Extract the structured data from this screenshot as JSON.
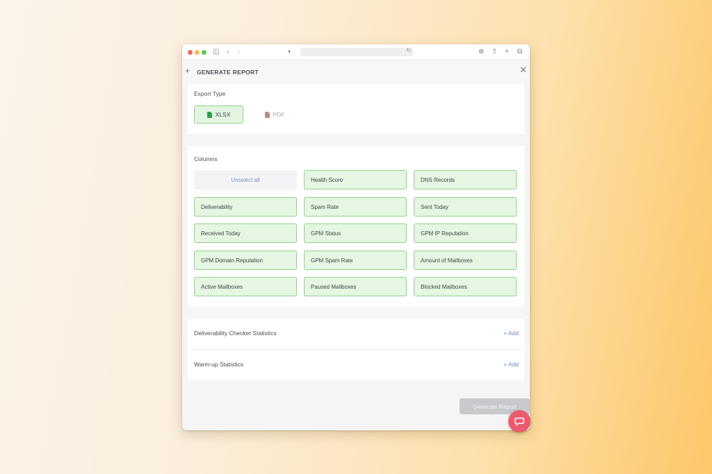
{
  "dialog": {
    "title": "GENERATE REPORT"
  },
  "export_type": {
    "label": "Export Type",
    "options": [
      {
        "label": "XLSX",
        "selected": true
      },
      {
        "label": "PDF",
        "selected": false
      }
    ]
  },
  "columns": {
    "label": "Columns",
    "unselect_all": "Unselect all",
    "items": [
      "Health Score",
      "DNS Records",
      "Deliverability",
      "Spam Rate",
      "Sent Today",
      "Received Today",
      "GPM Status",
      "GPM IP Reputation",
      "GPM Domain Reputation",
      "GPM Spam Rate",
      "Amount of Mailboxes",
      "Active Mailboxes",
      "Paused Mailboxes",
      "Blocked Mailboxes"
    ]
  },
  "sections": [
    {
      "label": "Deliverability Checker Statistics",
      "action": "+ Add"
    },
    {
      "label": "Warm-up Statistics",
      "action": "+ Add"
    }
  ],
  "footer": {
    "generate_label": "Generate Report"
  },
  "colors": {
    "selected_bg": "#e5f6e2",
    "selected_border": "#8fd28a",
    "link": "#6f8ac4",
    "chat": "#ec5a6f"
  },
  "icons": [
    "sidebar-icon",
    "back-icon",
    "forward-icon",
    "shield-icon",
    "reload-icon",
    "download-icon",
    "share-icon",
    "new-tab-icon",
    "tabs-icon",
    "plus-icon",
    "close-icon",
    "file-icon",
    "chat-icon"
  ]
}
